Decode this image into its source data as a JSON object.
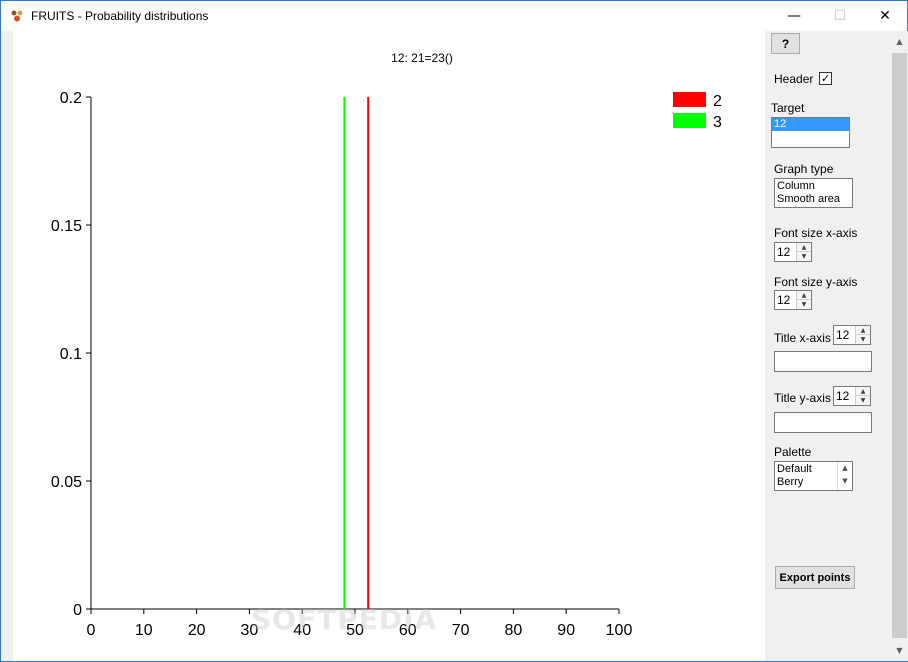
{
  "window": {
    "title": "FRUITS - Probability distributions",
    "controls": {
      "minimize": "—",
      "maximize": "☐",
      "close": "✕"
    }
  },
  "chart_data": {
    "type": "line",
    "title": "12: 21=23()",
    "xlabel": "",
    "ylabel": "",
    "xlim": [
      0,
      100
    ],
    "ylim": [
      0,
      0.2
    ],
    "x_ticks": [
      "0",
      "10",
      "20",
      "30",
      "40",
      "50",
      "60",
      "70",
      "80",
      "90",
      "100"
    ],
    "y_ticks": [
      "0",
      "0.05",
      "0.1",
      "0.15",
      "0.2"
    ],
    "series": [
      {
        "name": "2",
        "color": "#ff0000",
        "points": [
          [
            52.5,
            0
          ],
          [
            52.5,
            0.2
          ]
        ]
      },
      {
        "name": "3",
        "color": "#00ff00",
        "points": [
          [
            48,
            0
          ],
          [
            48,
            0.2
          ]
        ]
      }
    ],
    "legend_position": "top-right",
    "grid": false
  },
  "watermark": "SOFTPEDIA",
  "panel": {
    "help_label": "?",
    "header_label": "Header",
    "header_checked": "✓",
    "target_label": "Target",
    "target_items": [
      "12"
    ],
    "graph_type_label": "Graph type",
    "graph_type_items": [
      "Column",
      "Smooth area"
    ],
    "font_x_label": "Font size x-axis",
    "font_x_value": "12",
    "font_y_label": "Font size y-axis",
    "font_y_value": "12",
    "title_x_label": "Title x-axis",
    "title_x_size": "12",
    "title_x_value": "",
    "title_y_label": "Title y-axis",
    "title_y_size": "12",
    "title_y_value": "",
    "palette_label": "Palette",
    "palette_items": [
      "Default",
      "Berry"
    ],
    "export_label": "Export points"
  }
}
